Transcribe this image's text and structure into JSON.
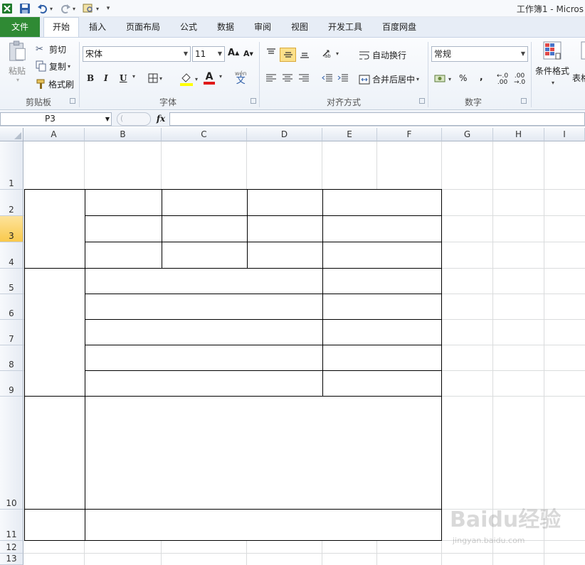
{
  "window": {
    "title": "工作簿1 - Micros"
  },
  "tabs": [
    {
      "label": "文件"
    },
    {
      "label": "开始"
    },
    {
      "label": "插入"
    },
    {
      "label": "页面布局"
    },
    {
      "label": "公式"
    },
    {
      "label": "数据"
    },
    {
      "label": "审阅"
    },
    {
      "label": "视图"
    },
    {
      "label": "开发工具"
    },
    {
      "label": "百度网盘"
    }
  ],
  "ribbon": {
    "clipboard": {
      "paste": "粘贴",
      "cut": "剪切",
      "copy": "复制",
      "format_painter": "格式刷",
      "group": "剪贴板"
    },
    "font": {
      "font_name": "宋体",
      "font_size": "11",
      "bold": "B",
      "italic": "I",
      "underline": "U",
      "group": "字体"
    },
    "alignment": {
      "wrap_text": "自动换行",
      "merge_center": "合并后居中",
      "group": "对齐方式"
    },
    "number": {
      "format": "常规",
      "percent": "%",
      "comma": ",",
      "group": "数字"
    },
    "styles": {
      "conditional_format": "条件格式",
      "table_format": "表格"
    }
  },
  "formula_bar": {
    "name_box": "P3",
    "fx": "fx",
    "value": ""
  },
  "grid": {
    "columns": [
      "A",
      "B",
      "C",
      "D",
      "E",
      "F",
      "G",
      "H",
      "I"
    ],
    "rows": [
      "1",
      "2",
      "3",
      "4",
      "5",
      "6",
      "7",
      "8",
      "9",
      "10",
      "11",
      "12",
      "13"
    ],
    "active_row": "3",
    "active_cell": "P3"
  },
  "watermark": {
    "brand": "Baidu经验",
    "url": "jingyan.baidu.com"
  },
  "colors": {
    "file_tab": "#2f8a34",
    "active_header": "#f9c94c",
    "gridline": "#dadcdd",
    "ribbon_bg": "#edf2f8"
  }
}
